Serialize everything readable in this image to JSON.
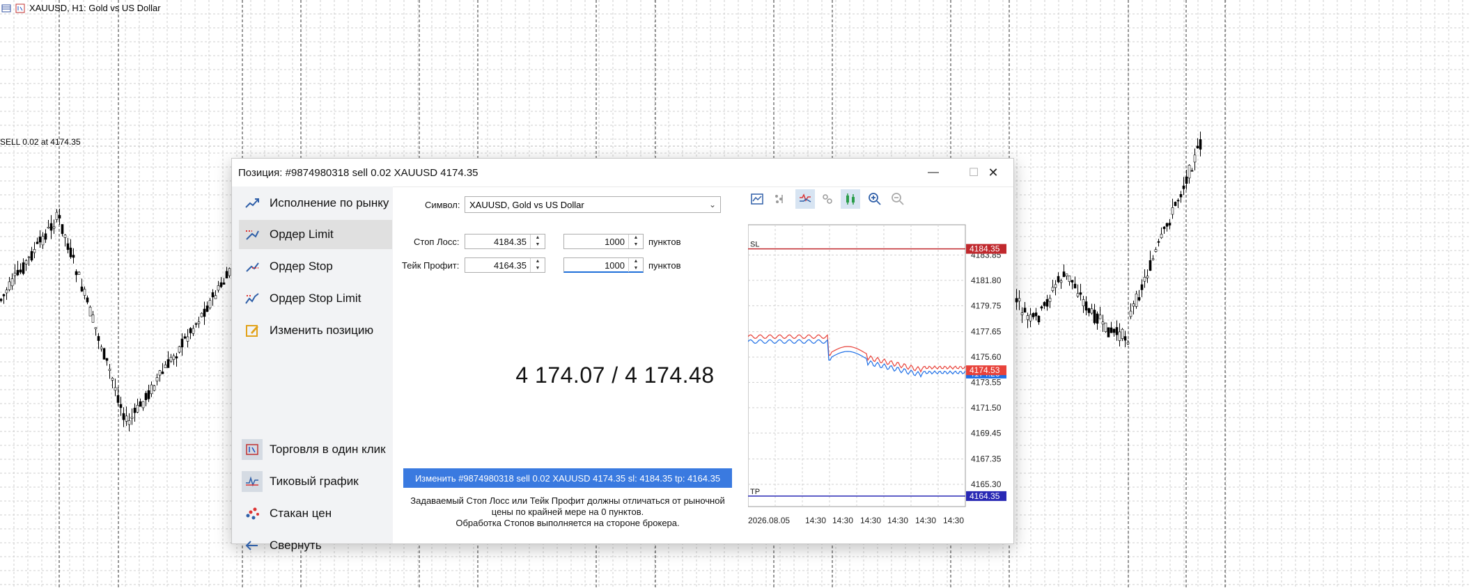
{
  "chart_window": {
    "title": "XAUUSD, H1:  Gold vs US Dollar",
    "order_line_label": "SELL 0.02 at 4174.35"
  },
  "dialog": {
    "title": "Позиция: #9874980318 sell 0.02 XAUUSD 4174.35",
    "window_controls": {
      "minimize": "—",
      "maximize": "☐",
      "close": "✕"
    },
    "sidebar": {
      "items": [
        {
          "label": "Исполнение по рынку",
          "icon": "market-execution-icon"
        },
        {
          "label": "Ордер Limit",
          "icon": "limit-order-icon",
          "active": true
        },
        {
          "label": "Ордер Stop",
          "icon": "stop-order-icon"
        },
        {
          "label": "Ордер Stop Limit",
          "icon": "stop-limit-order-icon"
        },
        {
          "label": "Изменить позицию",
          "icon": "edit-position-icon"
        }
      ],
      "bottom_items": [
        {
          "label": "Торговля в один клик",
          "icon": "one-click-trading-icon"
        },
        {
          "label": "Тиковый график",
          "icon": "tick-chart-icon"
        },
        {
          "label": "Стакан цен",
          "icon": "depth-of-market-icon"
        },
        {
          "label": "Свернуть",
          "icon": "arrow-left-icon"
        }
      ]
    },
    "form": {
      "symbol_label": "Символ:",
      "symbol_value": "XAUUSD, Gold vs US Dollar",
      "stop_loss_label": "Стоп Лосс:",
      "stop_loss_price": "4184.35",
      "stop_loss_points": "1000",
      "take_profit_label": "Тейк Профит:",
      "take_profit_price": "4164.35",
      "take_profit_points": "1000",
      "points_unit": "пунктов"
    },
    "quote": "4 174.07 / 4 174.48",
    "modify_button": "Изменить #9874980318 sell 0.02 XAUUSD 4174.35 sl: 4184.35 tp: 4164.35",
    "hint_lines": [
      "Задаваемый Стоп Лосс или Тейк Профит должны отличаться от рыночной",
      "цены по крайней мере на 0 пунктов.",
      "Обработка Стопов выполняется на стороне брокера."
    ],
    "tick_chart": {
      "toolbar_icons": [
        "chart-settings-icon",
        "ticks-icon",
        "bid-ask-icon",
        "deals-icon",
        "bars-icon",
        "zoom-in-icon",
        "zoom-out-icon"
      ],
      "sl_label": "SL",
      "tp_label": "TP",
      "sl_value": "4184.35",
      "tp_value": "4164.35",
      "ask_value": "4174.53",
      "bid_value": "4174.26",
      "y_ticks": [
        "4183.85",
        "4181.80",
        "4179.75",
        "4177.65",
        "4175.60",
        "4173.55",
        "4171.50",
        "4169.45",
        "4167.35",
        "4165.30"
      ],
      "x_ticks": [
        "2026.08.05",
        "14:30",
        "14:30",
        "14:30",
        "14:30",
        "14:30",
        "14:30"
      ],
      "colors": {
        "sl": "#c0282d",
        "tp": "#2828b4",
        "ask": "#e8423a",
        "bid": "#1e6fe6"
      }
    }
  }
}
